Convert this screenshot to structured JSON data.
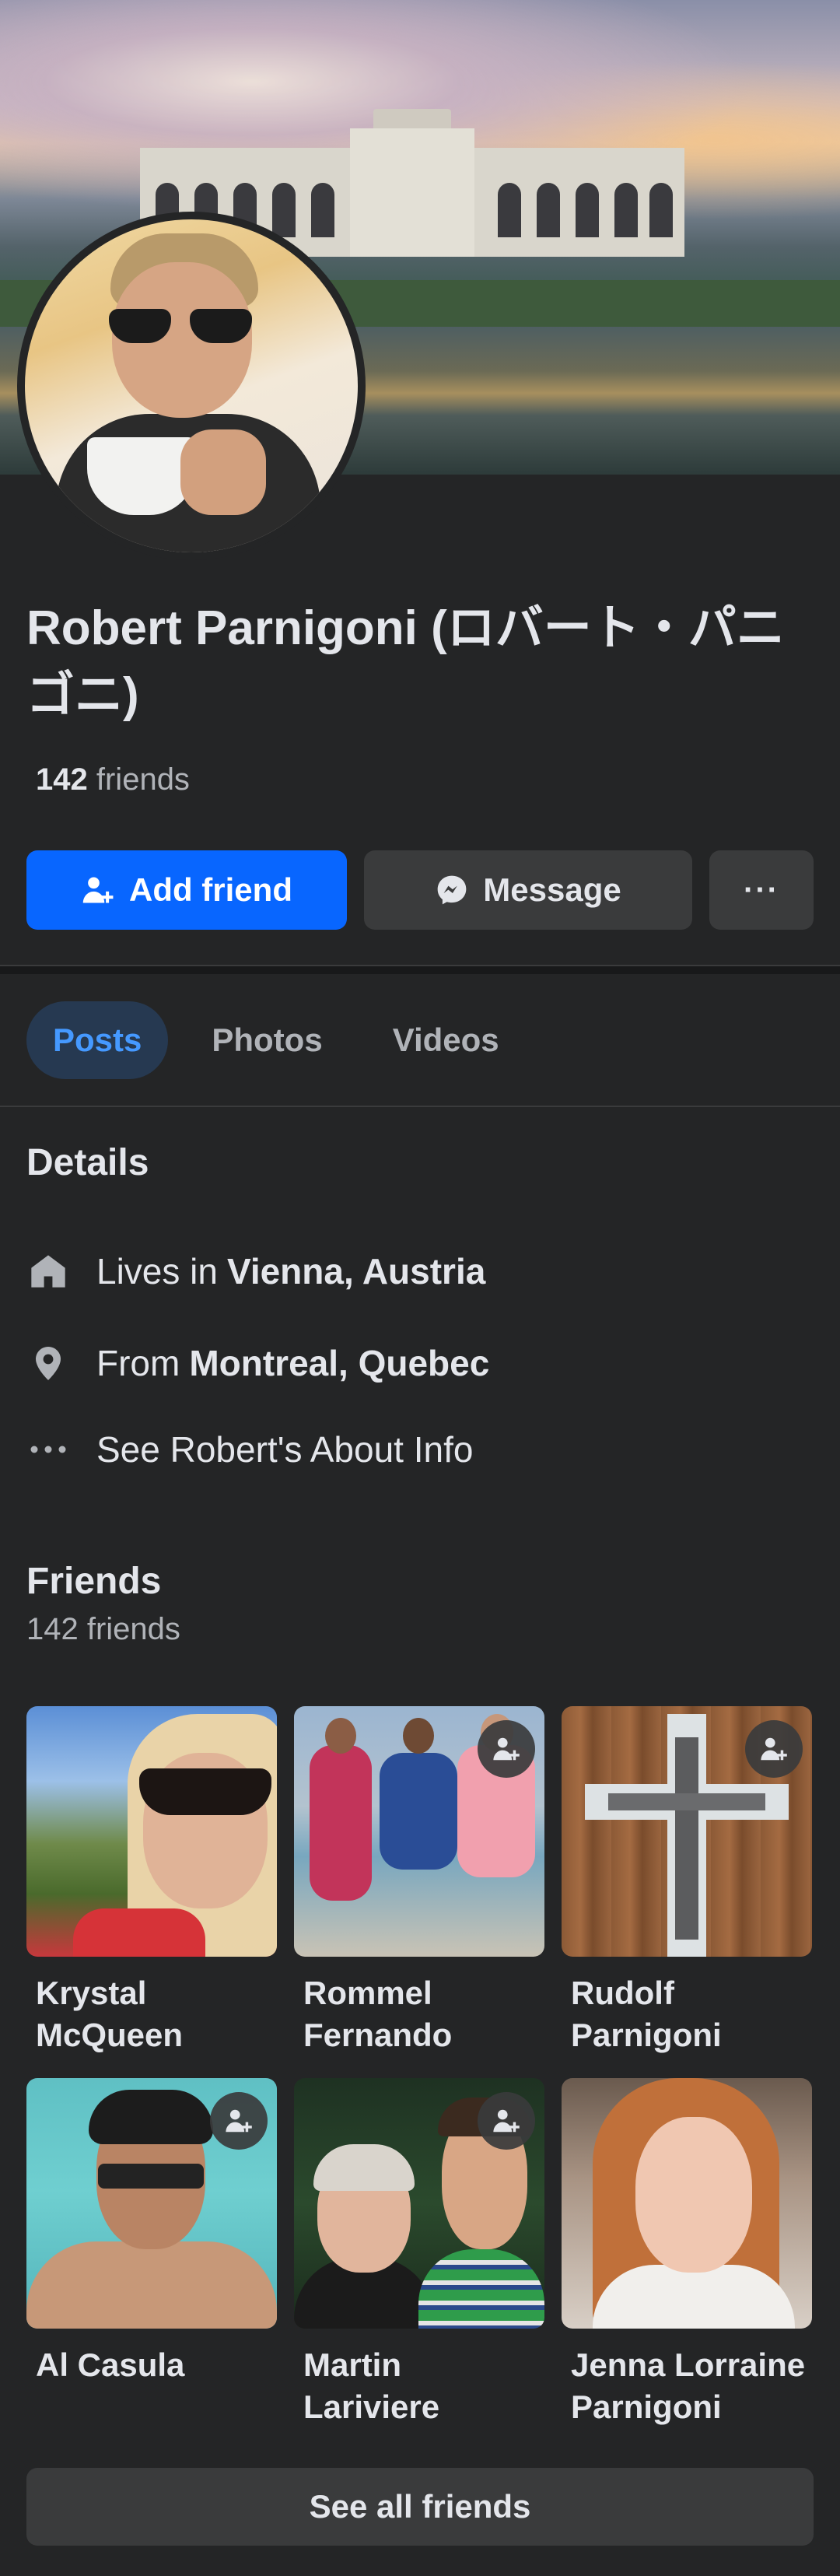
{
  "profile": {
    "name": "Robert Parnigoni (ロバート・パニゴニ)",
    "friends_count": "142",
    "friends_suffix": "friends"
  },
  "actions": {
    "add_friend": "Add friend",
    "message": "Message",
    "more": "···"
  },
  "tabs": [
    {
      "label": "Posts",
      "active": true
    },
    {
      "label": "Photos",
      "active": false
    },
    {
      "label": "Videos",
      "active": false
    }
  ],
  "details": {
    "title": "Details",
    "lives_prefix": "Lives in",
    "lives_place": "Vienna, Austria",
    "from_prefix": "From",
    "from_place": "Montreal, Quebec",
    "about": "See Robert's About Info"
  },
  "friends": {
    "title": "Friends",
    "subtitle": "142 friends",
    "items": [
      {
        "name": "Krystal McQueen",
        "add_button": false
      },
      {
        "name": "Rommel Fernando",
        "add_button": true
      },
      {
        "name": "Rudolf Parnigoni",
        "add_button": true
      },
      {
        "name": "Al Casula",
        "add_button": true
      },
      {
        "name": "Martin Lariviere",
        "add_button": true
      },
      {
        "name": "Jenna Lorraine Parnigoni",
        "add_button": false
      }
    ],
    "see_all": "See all friends"
  },
  "colors": {
    "background": "#242526",
    "primary_button": "#0866ff",
    "secondary_button": "#3a3b3c",
    "active_tab_bg": "#263951",
    "active_tab_text": "#4599ff"
  },
  "icons": {
    "add_friend": "person-plus-icon",
    "message": "messenger-icon",
    "more": "more-dots-icon",
    "lives": "home-icon",
    "from": "location-pin-icon",
    "about": "ellipsis-icon"
  }
}
